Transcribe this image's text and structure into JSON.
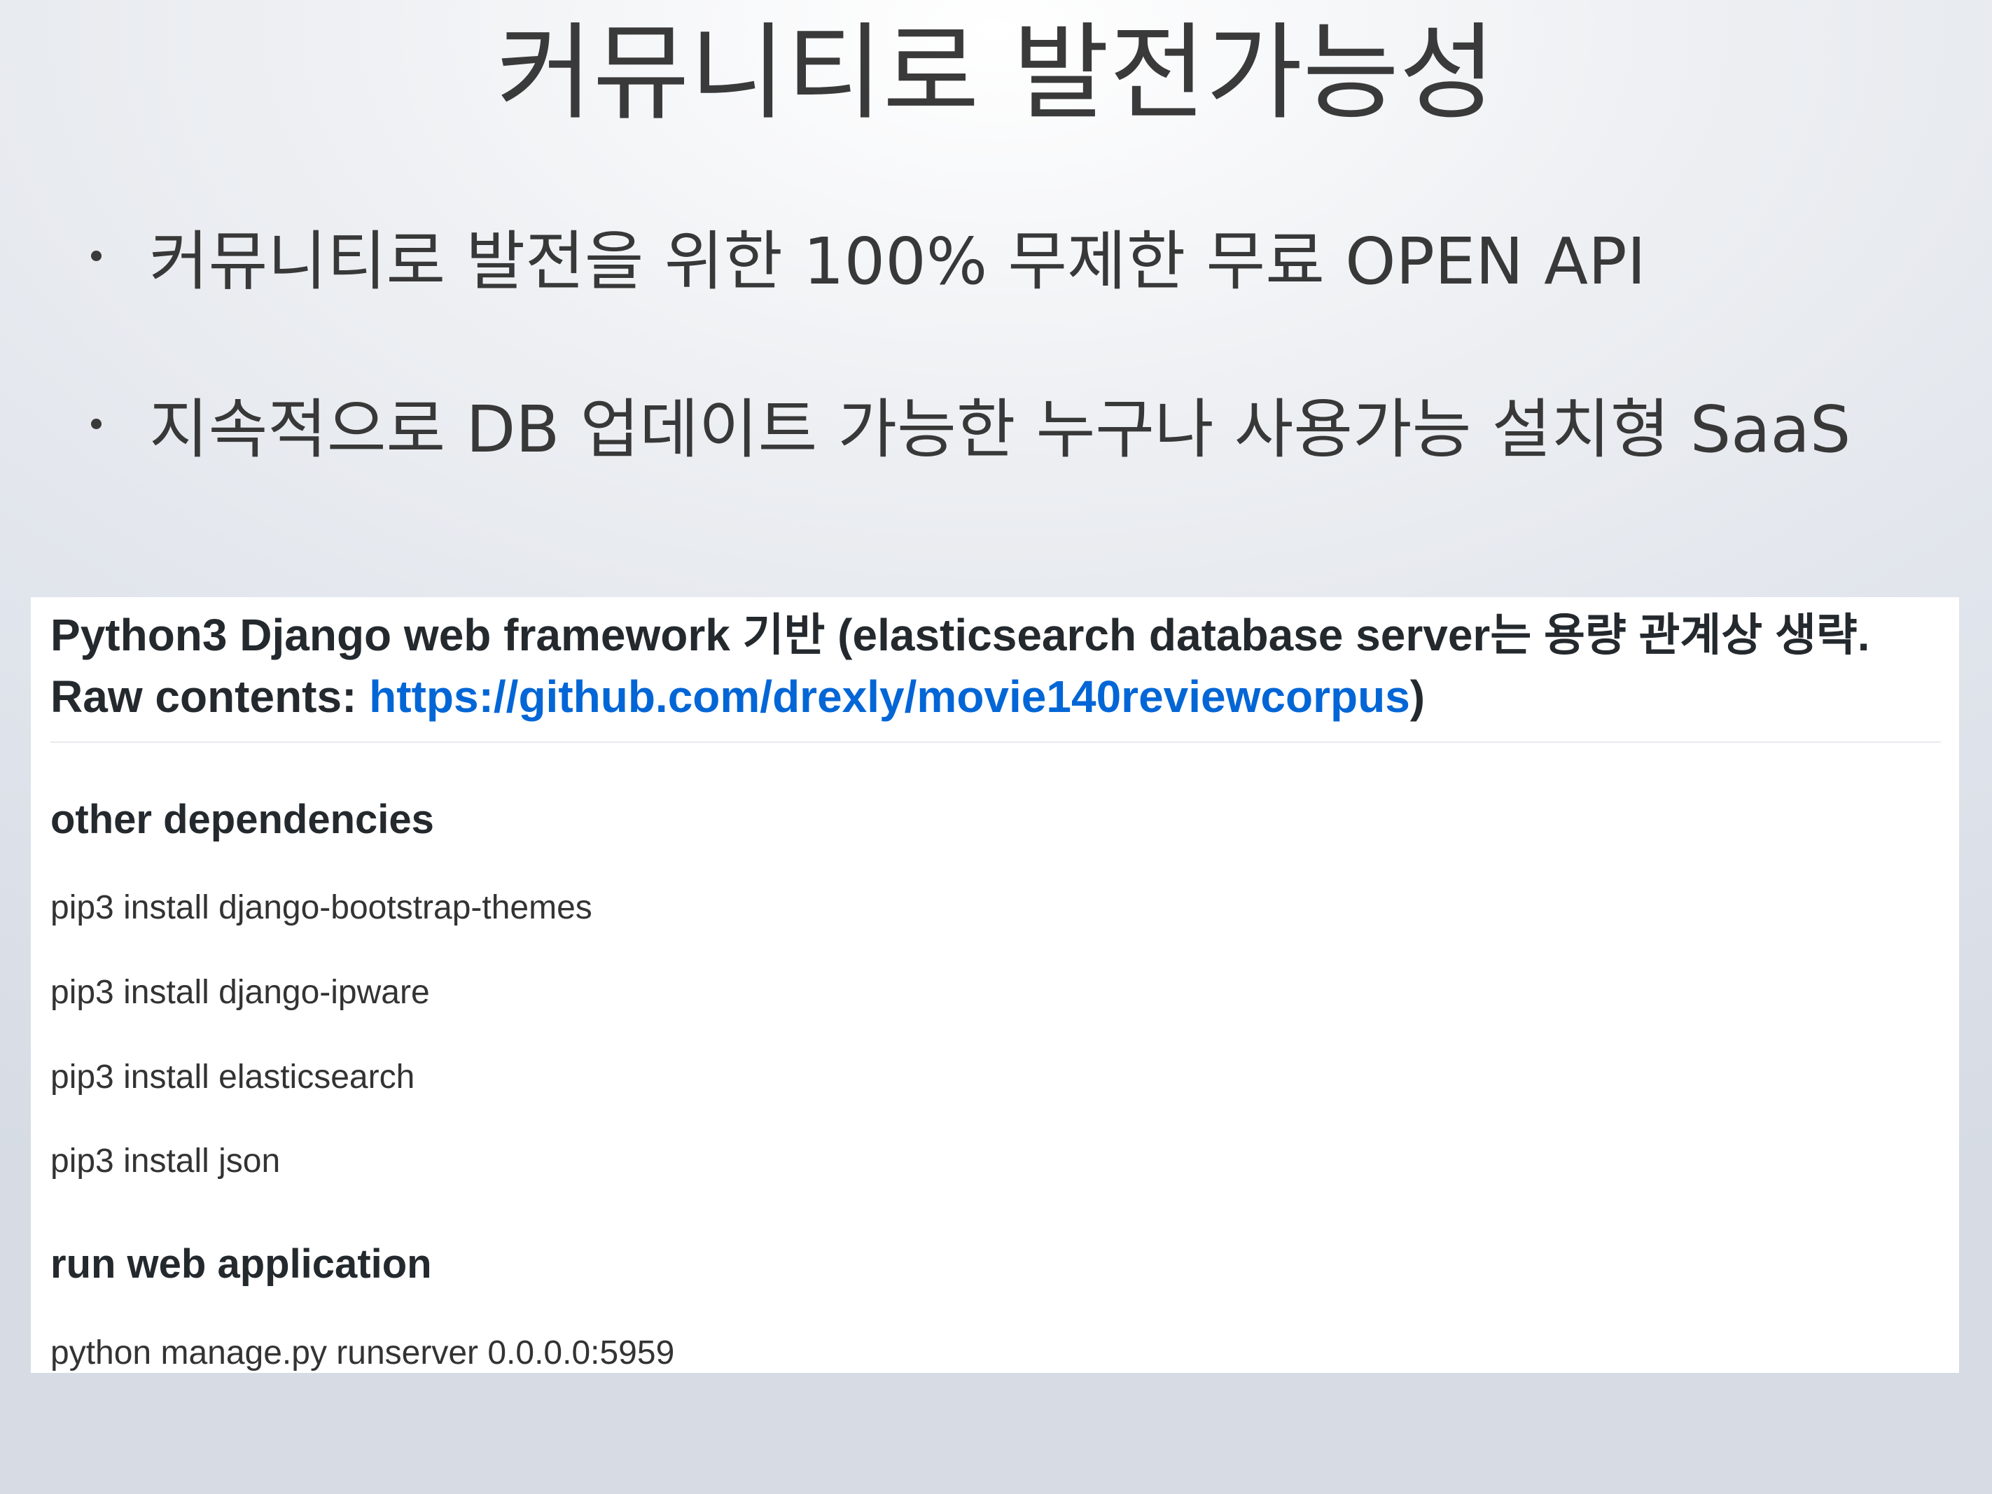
{
  "slide": {
    "title": "커뮤니티로 발전가능성",
    "bullets": [
      "커뮤니티로 발전을 위한 100% 무제한 무료 OPEN API",
      "지속적으로 DB 업데이트 가능한 누구나 사용가능 설치형 SaaS"
    ]
  },
  "readme": {
    "intro_prefix": "Python3 Django web framework 기반 (elasticsearch database server는 용량 관계상 생략. Raw contents: ",
    "intro_link": "https://github.com/drexly/movie140reviewcorpus",
    "intro_suffix": ")",
    "link_color": "#0366d6",
    "dependencies_heading": "other dependencies",
    "dependencies": [
      "pip3 install django-bootstrap-themes",
      "pip3 install django-ipware",
      "pip3 install elasticsearch",
      "pip3 install json"
    ],
    "run_heading": "run web application",
    "run_command": "python manage.py runserver 0.0.0.0:5959"
  }
}
